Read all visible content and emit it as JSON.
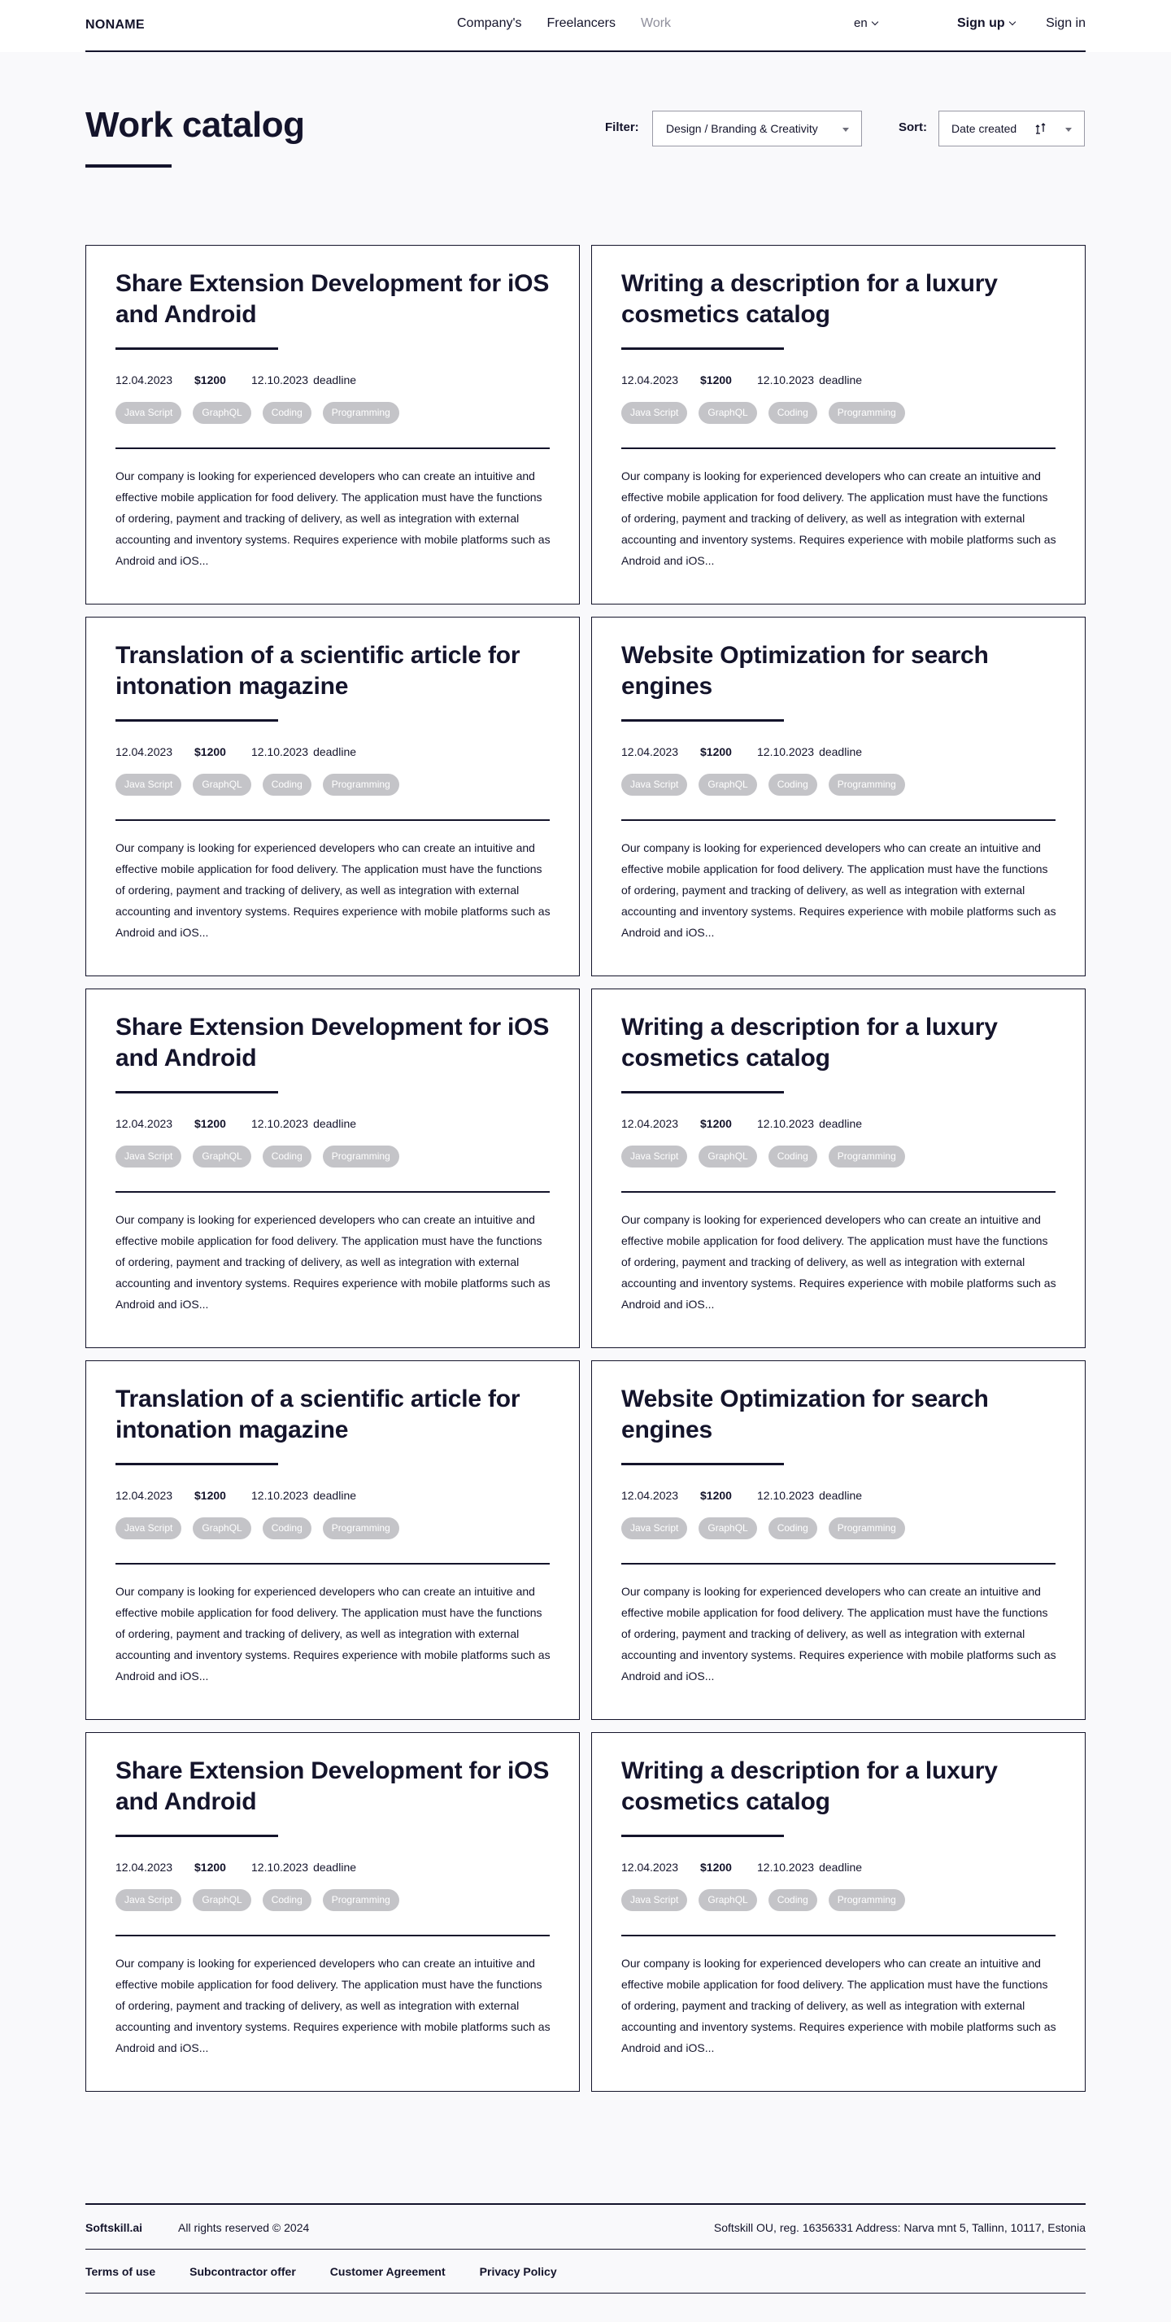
{
  "header": {
    "logo": "NONAME",
    "nav": [
      "Company's",
      "Freelancers",
      "Work"
    ],
    "language": "en",
    "signup": "Sign up",
    "signin": "Sign in"
  },
  "page": {
    "title": "Work catalog",
    "filter_label": "Filter:",
    "filter_value": "Design / Branding & Creativity",
    "sort_label": "Sort:",
    "sort_value": "Date created"
  },
  "cards": [
    {
      "title": "Share Extension Development for iOS and Android",
      "date": "12.04.2023",
      "price": "$1200",
      "deadline_date": "12.10.2023",
      "deadline_label": "deadline",
      "tags": [
        "Java Script",
        "GraphQL",
        "Coding",
        "Programming"
      ],
      "description": "Our company is looking for experienced developers who can create an intuitive and effective mobile application for food delivery. The application must have the functions of ordering, payment and tracking of delivery, as well as integration with external accounting and inventory systems. Requires experience with mobile platforms such as Android and iOS..."
    },
    {
      "title": "Writing a description for a luxury cosmetics catalog",
      "date": "12.04.2023",
      "price": "$1200",
      "deadline_date": "12.10.2023",
      "deadline_label": "deadline",
      "tags": [
        "Java Script",
        "GraphQL",
        "Coding",
        "Programming"
      ],
      "description": "Our company is looking for experienced developers who can create an intuitive and effective mobile application for food delivery. The application must have the functions of ordering, payment and tracking of delivery, as well as integration with external accounting and inventory systems. Requires experience with mobile platforms such as Android and iOS..."
    },
    {
      "title": "Translation of a scientific article for intonation magazine",
      "date": "12.04.2023",
      "price": "$1200",
      "deadline_date": "12.10.2023",
      "deadline_label": "deadline",
      "tags": [
        "Java Script",
        "GraphQL",
        "Coding",
        "Programming"
      ],
      "description": "Our company is looking for experienced developers who can create an intuitive and effective mobile application for food delivery. The application must have the functions of ordering, payment and tracking of delivery, as well as integration with external accounting and inventory systems. Requires experience with mobile platforms such as Android and iOS..."
    },
    {
      "title": "Website Optimization for search engines",
      "date": "12.04.2023",
      "price": "$1200",
      "deadline_date": "12.10.2023",
      "deadline_label": "deadline",
      "tags": [
        "Java Script",
        "GraphQL",
        "Coding",
        "Programming"
      ],
      "description": "Our company is looking for experienced developers who can create an intuitive and effective mobile application for food delivery. The application must have the functions of ordering, payment and tracking of delivery, as well as integration with external accounting and inventory systems. Requires experience with mobile platforms such as Android and iOS..."
    },
    {
      "title": "Share Extension Development for iOS and Android",
      "date": "12.04.2023",
      "price": "$1200",
      "deadline_date": "12.10.2023",
      "deadline_label": "deadline",
      "tags": [
        "Java Script",
        "GraphQL",
        "Coding",
        "Programming"
      ],
      "description": "Our company is looking for experienced developers who can create an intuitive and effective mobile application for food delivery. The application must have the functions of ordering, payment and tracking of delivery, as well as integration with external accounting and inventory systems. Requires experience with mobile platforms such as Android and iOS..."
    },
    {
      "title": "Writing a description for a luxury cosmetics catalog",
      "date": "12.04.2023",
      "price": "$1200",
      "deadline_date": "12.10.2023",
      "deadline_label": "deadline",
      "tags": [
        "Java Script",
        "GraphQL",
        "Coding",
        "Programming"
      ],
      "description": "Our company is looking for experienced developers who can create an intuitive and effective mobile application for food delivery. The application must have the functions of ordering, payment and tracking of delivery, as well as integration with external accounting and inventory systems. Requires experience with mobile platforms such as Android and iOS..."
    },
    {
      "title": "Translation of a scientific article for intonation magazine",
      "date": "12.04.2023",
      "price": "$1200",
      "deadline_date": "12.10.2023",
      "deadline_label": "deadline",
      "tags": [
        "Java Script",
        "GraphQL",
        "Coding",
        "Programming"
      ],
      "description": "Our company is looking for experienced developers who can create an intuitive and effective mobile application for food delivery. The application must have the functions of ordering, payment and tracking of delivery, as well as integration with external accounting and inventory systems. Requires experience with mobile platforms such as Android and iOS..."
    },
    {
      "title": "Website Optimization for search engines",
      "date": "12.04.2023",
      "price": "$1200",
      "deadline_date": "12.10.2023",
      "deadline_label": "deadline",
      "tags": [
        "Java Script",
        "GraphQL",
        "Coding",
        "Programming"
      ],
      "description": "Our company is looking for experienced developers who can create an intuitive and effective mobile application for food delivery. The application must have the functions of ordering, payment and tracking of delivery, as well as integration with external accounting and inventory systems. Requires experience with mobile platforms such as Android and iOS..."
    },
    {
      "title": "Share Extension Development for iOS and Android",
      "date": "12.04.2023",
      "price": "$1200",
      "deadline_date": "12.10.2023",
      "deadline_label": "deadline",
      "tags": [
        "Java Script",
        "GraphQL",
        "Coding",
        "Programming"
      ],
      "description": "Our company is looking for experienced developers who can create an intuitive and effective mobile application for food delivery. The application must have the functions of ordering, payment and tracking of delivery, as well as integration with external accounting and inventory systems. Requires experience with mobile platforms such as Android and iOS..."
    },
    {
      "title": "Writing a description for a luxury cosmetics catalog",
      "date": "12.04.2023",
      "price": "$1200",
      "deadline_date": "12.10.2023",
      "deadline_label": "deadline",
      "tags": [
        "Java Script",
        "GraphQL",
        "Coding",
        "Programming"
      ],
      "description": "Our company is looking for experienced developers who can create an intuitive and effective mobile application for food delivery. The application must have the functions of ordering, payment and tracking of delivery, as well as integration with external accounting and inventory systems. Requires experience with mobile platforms such as Android and iOS..."
    }
  ],
  "footer": {
    "brand": "Softskill.ai",
    "rights": "All rights reserved © 2024",
    "address": "Softskill OU, reg. 16356331 Address: Narva mnt 5, Tallinn, 10117, Estonia",
    "links": [
      "Terms of use",
      "Subcontractor offer",
      "Customer Agreement",
      "Privacy Policy"
    ]
  }
}
